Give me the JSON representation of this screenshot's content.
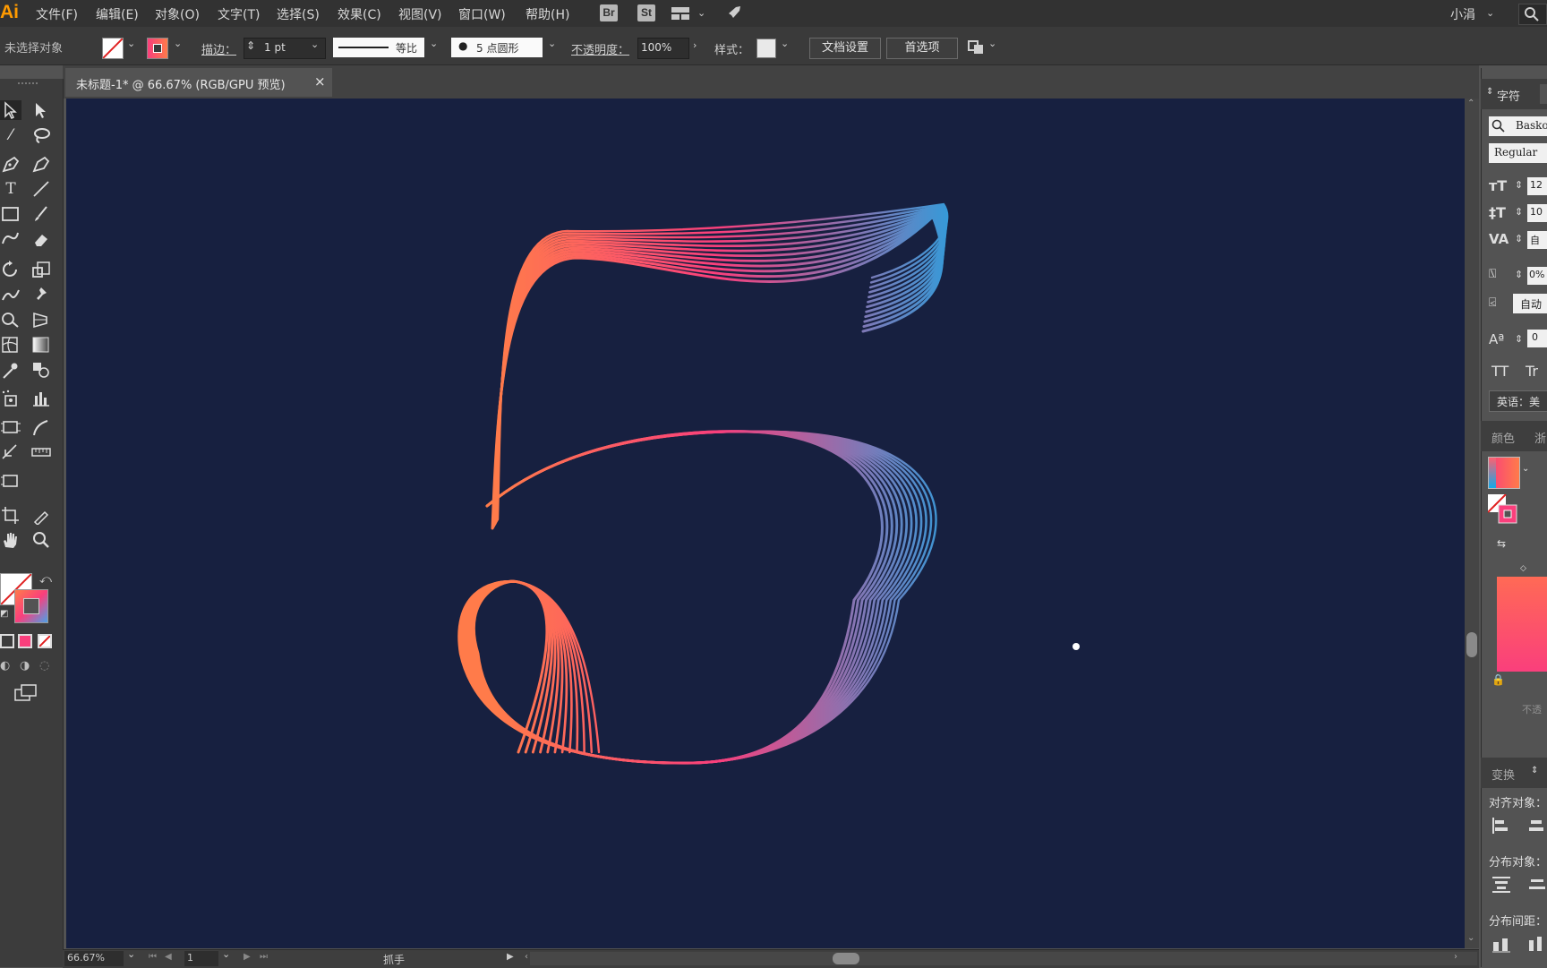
{
  "app": {
    "logo": "Ai"
  },
  "menu": {
    "items": [
      "文件(F)",
      "编辑(E)",
      "对象(O)",
      "文字(T)",
      "选择(S)",
      "效果(C)",
      "视图(V)",
      "窗口(W)",
      "帮助(H)"
    ],
    "bridge": "Br",
    "stock": "St",
    "user": "小涓"
  },
  "control": {
    "selection_status": "未选择对象",
    "stroke_label": "描边：",
    "stroke_weight": "1 pt",
    "stroke_profile": "等比",
    "brush": "5 点圆形",
    "opacity_label": "不透明度：",
    "opacity_value": "100%",
    "style_label": "样式：",
    "doc_setup_button": "文档设置",
    "preferences_button": "首选项"
  },
  "document": {
    "tab_title": "未标题-1* @ 66.67% (RGB/GPU 预览)",
    "close_symbol": "×",
    "artwork_glyph": "5"
  },
  "status": {
    "zoom": "66.67%",
    "artboard": "1",
    "tool_name": "抓手"
  },
  "panels": {
    "character": {
      "tab": "字符",
      "font_family": "Basko",
      "font_style": "Regular",
      "font_size": "12",
      "leading": "10",
      "kerning": "自",
      "tracking_percent": "0%",
      "auto_label": "自动",
      "baseline": "0",
      "tt_caps": "TT",
      "tt_small": "Tr",
      "language": "英语：美"
    },
    "color": {
      "tab": "颜色",
      "tab2": "浙",
      "opacity_hint": "不透"
    },
    "align": {
      "tab": "变换",
      "align_objects": "对齐对象：",
      "distribute_objects": "分布对象：",
      "distribute_spacing": "分布间距："
    }
  },
  "colors": {
    "canvas_bg": "#172040",
    "gradient_start": "#ff7b4a",
    "gradient_mid": "#fa3f7c",
    "gradient_end": "#14a9e8"
  },
  "icons": {
    "selection_tool": "arrow-icon",
    "direct_selection_tool": "direct-arrow-icon",
    "magic_wand_tool": "wand-icon",
    "lasso_tool": "lasso-icon",
    "pen_tool": "pen-icon",
    "type_tool": "type-icon",
    "line_tool": "line-icon",
    "rectangle_tool": "rect-icon",
    "brush_tool": "brush-icon",
    "eraser_tool": "eraser-icon",
    "rotate_tool": "rotate-icon",
    "scale_tool": "scale-icon",
    "hand_tool": "hand-icon",
    "zoom_tool": "zoom-icon"
  }
}
